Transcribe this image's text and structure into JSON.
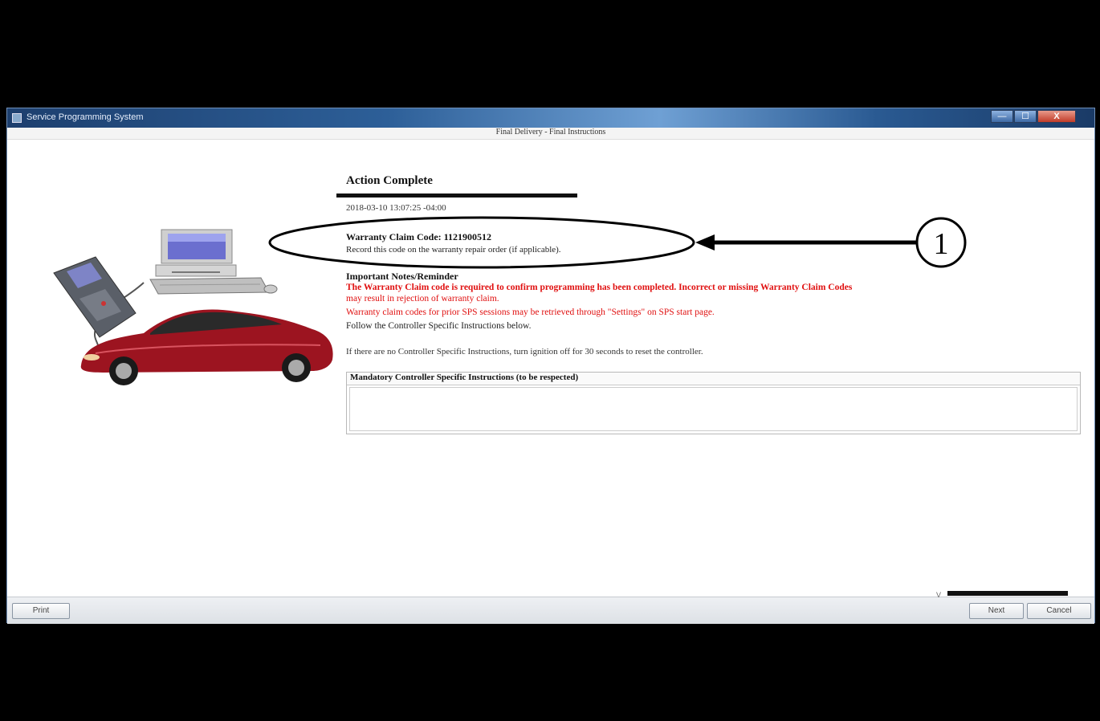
{
  "window": {
    "title": "Service Programming System",
    "subtitle": "Final Delivery - Final Instructions",
    "min_glyph": "—",
    "max_glyph": "☐",
    "close_glyph": "X"
  },
  "main": {
    "heading": "Action Complete",
    "timestamp": "2018-03-10 13:07:25 -04:00",
    "warranty_code_label": "Warranty Claim Code:",
    "warranty_code_value": "1121900512",
    "record_instruction": "Record this code on the warranty repair order (if applicable).",
    "notes_heading": "Important Notes/Reminder",
    "warning_line1": "The Warranty Claim code is required to confirm programming has been completed. Incorrect or missing Warranty Claim Codes",
    "warning_line2": "may result in rejection of warranty claim.",
    "warning_line3": "Warranty claim codes for prior SPS sessions may be retrieved through \"Settings\" on SPS start page.",
    "follow_text": "Follow the Controller Specific Instructions below.",
    "info_text": "If there are no Controller Specific Instructions, turn ignition off for 30 seconds to reset the controller.",
    "instructions_box_title": "Mandatory Controller Specific Instructions (to be respected)"
  },
  "annotation": {
    "callout_number": "1"
  },
  "footer": {
    "version_prefix": "V",
    "print_label": "Print",
    "next_label": "Next",
    "cancel_label": "Cancel"
  },
  "colors": {
    "warning_red": "#e01010",
    "titlebar_blue": "#2d5f98",
    "car_red": "#9c1420"
  },
  "icons": [
    "app-icon",
    "computer-icon",
    "scan-tool-icon",
    "car-icon",
    "arrow-icon"
  ]
}
